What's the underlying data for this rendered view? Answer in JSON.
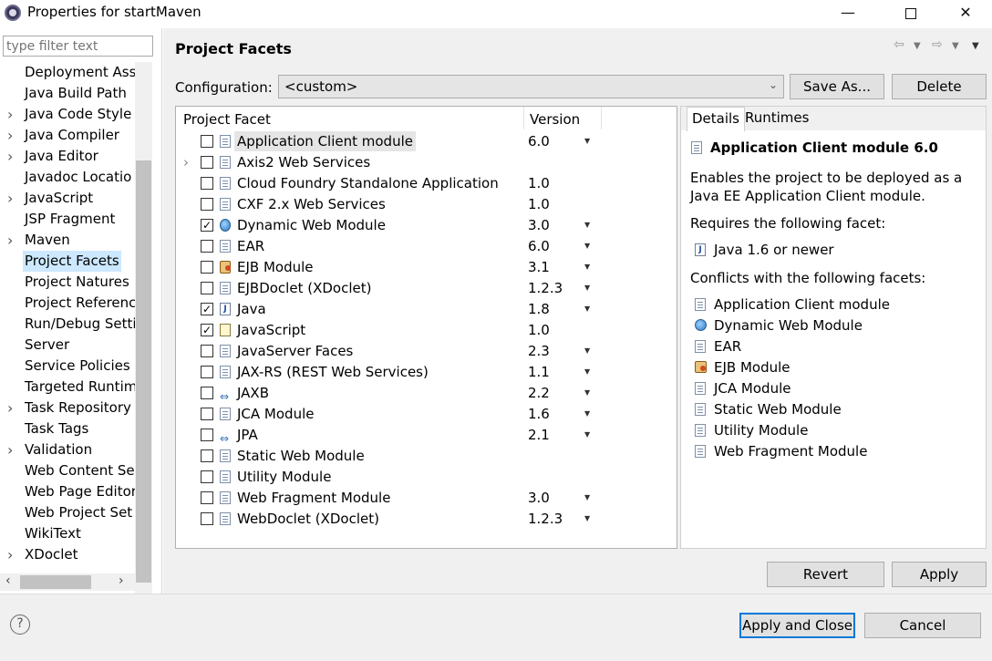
{
  "window": {
    "title": "Properties for startMaven",
    "minimize_glyph": "—",
    "close_glyph": "✕"
  },
  "filter": {
    "placeholder": "type filter text"
  },
  "nav": {
    "items": [
      {
        "label": "Deployment Ass",
        "expandable": false,
        "selected": false
      },
      {
        "label": "Java Build Path",
        "expandable": false,
        "selected": false
      },
      {
        "label": "Java Code Style",
        "expandable": true,
        "selected": false
      },
      {
        "label": "Java Compiler",
        "expandable": true,
        "selected": false
      },
      {
        "label": "Java Editor",
        "expandable": true,
        "selected": false
      },
      {
        "label": "Javadoc Locatio",
        "expandable": false,
        "selected": false
      },
      {
        "label": "JavaScript",
        "expandable": true,
        "selected": false
      },
      {
        "label": "JSP Fragment",
        "expandable": false,
        "selected": false
      },
      {
        "label": "Maven",
        "expandable": true,
        "selected": false
      },
      {
        "label": "Project Facets",
        "expandable": false,
        "selected": true
      },
      {
        "label": "Project Natures",
        "expandable": false,
        "selected": false
      },
      {
        "label": "Project Referenc",
        "expandable": false,
        "selected": false
      },
      {
        "label": "Run/Debug Setti",
        "expandable": false,
        "selected": false
      },
      {
        "label": "Server",
        "expandable": false,
        "selected": false
      },
      {
        "label": "Service Policies",
        "expandable": false,
        "selected": false
      },
      {
        "label": "Targeted Runtim",
        "expandable": false,
        "selected": false
      },
      {
        "label": "Task Repository",
        "expandable": true,
        "selected": false
      },
      {
        "label": "Task Tags",
        "expandable": false,
        "selected": false
      },
      {
        "label": "Validation",
        "expandable": true,
        "selected": false
      },
      {
        "label": "Web Content Se",
        "expandable": false,
        "selected": false
      },
      {
        "label": "Web Page Editor",
        "expandable": false,
        "selected": false
      },
      {
        "label": "Web Project Set",
        "expandable": false,
        "selected": false
      },
      {
        "label": "WikiText",
        "expandable": false,
        "selected": false
      },
      {
        "label": "XDoclet",
        "expandable": true,
        "selected": false
      }
    ]
  },
  "page": {
    "title": "Project Facets",
    "config_label": "Configuration:",
    "config_value": "<custom>",
    "save_as_label": "Save As...",
    "delete_label": "Delete"
  },
  "facets": {
    "col_facet": "Project Facet",
    "col_version": "Version",
    "rows": [
      {
        "name": "Application Client module",
        "version": "6.0",
        "checked": false,
        "dropdown": true,
        "icon": "page-icon",
        "expandable": false,
        "selected": true
      },
      {
        "name": "Axis2 Web Services",
        "version": "",
        "checked": false,
        "dropdown": false,
        "icon": "page-icon",
        "expandable": true,
        "selected": false
      },
      {
        "name": "Cloud Foundry Standalone Application",
        "version": "1.0",
        "checked": false,
        "dropdown": false,
        "icon": "page-icon",
        "expandable": false,
        "selected": false
      },
      {
        "name": "CXF 2.x Web Services",
        "version": "1.0",
        "checked": false,
        "dropdown": false,
        "icon": "page-icon",
        "expandable": false,
        "selected": false
      },
      {
        "name": "Dynamic Web Module",
        "version": "3.0",
        "checked": true,
        "dropdown": true,
        "icon": "globe-icon",
        "expandable": false,
        "selected": false
      },
      {
        "name": "EAR",
        "version": "6.0",
        "checked": false,
        "dropdown": true,
        "icon": "page-icon",
        "expandable": false,
        "selected": false
      },
      {
        "name": "EJB Module",
        "version": "3.1",
        "checked": false,
        "dropdown": true,
        "icon": "ejb-icon",
        "expandable": false,
        "selected": false
      },
      {
        "name": "EJBDoclet (XDoclet)",
        "version": "1.2.3",
        "checked": false,
        "dropdown": true,
        "icon": "page-icon",
        "expandable": false,
        "selected": false
      },
      {
        "name": "Java",
        "version": "1.8",
        "checked": true,
        "dropdown": true,
        "icon": "java-icon",
        "expandable": false,
        "selected": false
      },
      {
        "name": "JavaScript",
        "version": "1.0",
        "checked": true,
        "dropdown": false,
        "icon": "javascript-icon",
        "expandable": false,
        "selected": false
      },
      {
        "name": "JavaServer Faces",
        "version": "2.3",
        "checked": false,
        "dropdown": true,
        "icon": "page-icon",
        "expandable": false,
        "selected": false
      },
      {
        "name": "JAX-RS (REST Web Services)",
        "version": "1.1",
        "checked": false,
        "dropdown": true,
        "icon": "page-icon",
        "expandable": false,
        "selected": false
      },
      {
        "name": "JAXB",
        "version": "2.2",
        "checked": false,
        "dropdown": true,
        "icon": "arrows-icon",
        "expandable": false,
        "selected": false
      },
      {
        "name": "JCA Module",
        "version": "1.6",
        "checked": false,
        "dropdown": true,
        "icon": "page-icon",
        "expandable": false,
        "selected": false
      },
      {
        "name": "JPA",
        "version": "2.1",
        "checked": false,
        "dropdown": true,
        "icon": "arrows-icon",
        "expandable": false,
        "selected": false
      },
      {
        "name": "Static Web Module",
        "version": "",
        "checked": false,
        "dropdown": false,
        "icon": "page-icon",
        "expandable": false,
        "selected": false
      },
      {
        "name": "Utility Module",
        "version": "",
        "checked": false,
        "dropdown": false,
        "icon": "page-icon",
        "expandable": false,
        "selected": false
      },
      {
        "name": "Web Fragment Module",
        "version": "3.0",
        "checked": false,
        "dropdown": true,
        "icon": "page-icon",
        "expandable": false,
        "selected": false
      },
      {
        "name": "WebDoclet (XDoclet)",
        "version": "1.2.3",
        "checked": false,
        "dropdown": true,
        "icon": "page-icon",
        "expandable": false,
        "selected": false
      }
    ]
  },
  "details": {
    "tab_details": "Details",
    "tab_runtimes": "Runtimes",
    "title": "Application Client module 6.0",
    "description": "Enables the project to be deployed as a Java EE Application Client module.",
    "requires_label": "Requires the following facet:",
    "requires": [
      {
        "name": "Java 1.6 or newer",
        "icon": "java-icon"
      }
    ],
    "conflicts_label": "Conflicts with the following facets:",
    "conflicts": [
      {
        "name": "Application Client module",
        "icon": "page-icon"
      },
      {
        "name": "Dynamic Web Module",
        "icon": "globe-icon"
      },
      {
        "name": "EAR",
        "icon": "page-icon"
      },
      {
        "name": "EJB Module",
        "icon": "ejb-icon"
      },
      {
        "name": "JCA Module",
        "icon": "page-icon"
      },
      {
        "name": "Static Web Module",
        "icon": "page-icon"
      },
      {
        "name": "Utility Module",
        "icon": "page-icon"
      },
      {
        "name": "Web Fragment Module",
        "icon": "page-icon"
      }
    ]
  },
  "buttons": {
    "revert": "Revert",
    "apply": "Apply",
    "apply_close": "Apply and Close",
    "cancel": "Cancel",
    "help": "?"
  },
  "colors": {
    "selection": "#cce8ff",
    "default_button_border": "#0078d7",
    "dialog_background": "#f0f0f0"
  }
}
